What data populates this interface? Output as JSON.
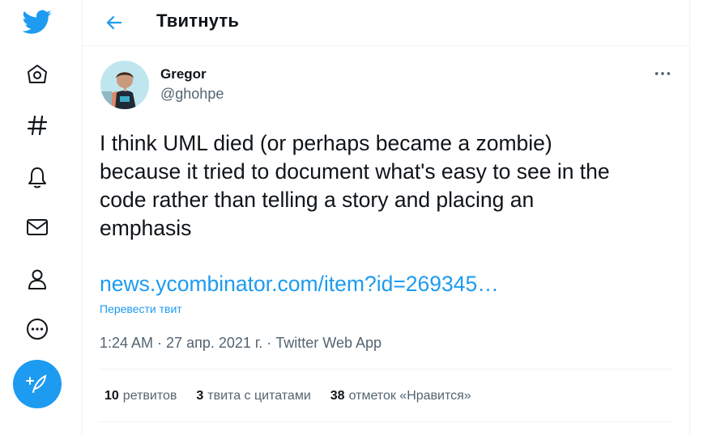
{
  "sidebar": {
    "logo": "twitter-bird-icon",
    "items": [
      {
        "icon": "home-icon"
      },
      {
        "icon": "hashtag-icon"
      },
      {
        "icon": "bell-icon"
      },
      {
        "icon": "mail-icon"
      },
      {
        "icon": "profile-icon"
      },
      {
        "icon": "more-circle-icon"
      }
    ],
    "compose_icon": "compose-tweet-icon"
  },
  "header": {
    "title": "Твитнуть",
    "back_icon": "arrow-left-icon"
  },
  "tweet": {
    "author_name": "Gregor",
    "author_handle": "@ghohpe",
    "text": "I think UML died (or perhaps became a zombie)\nbecause it tried to document what's easy to see in the\ncode rather than telling a story and placing an\nemphasis",
    "link": "news.ycombinator.com/item?id=269345…",
    "translate_label": "Перевести твит",
    "time": "1:24 AM",
    "date": "27 апр. 2021 г.",
    "source": "Twitter Web App",
    "separator": " · "
  },
  "stats": {
    "retweets_count": "10",
    "retweets_label": "ретвитов",
    "quotes_count": "3",
    "quotes_label": "твита с цитатами",
    "likes_count": "38",
    "likes_label": "отметок «Нравится»"
  },
  "colors": {
    "accent": "#1d9bf0",
    "text": "#0f1419",
    "secondary": "#536471",
    "border": "#eff3f4"
  }
}
